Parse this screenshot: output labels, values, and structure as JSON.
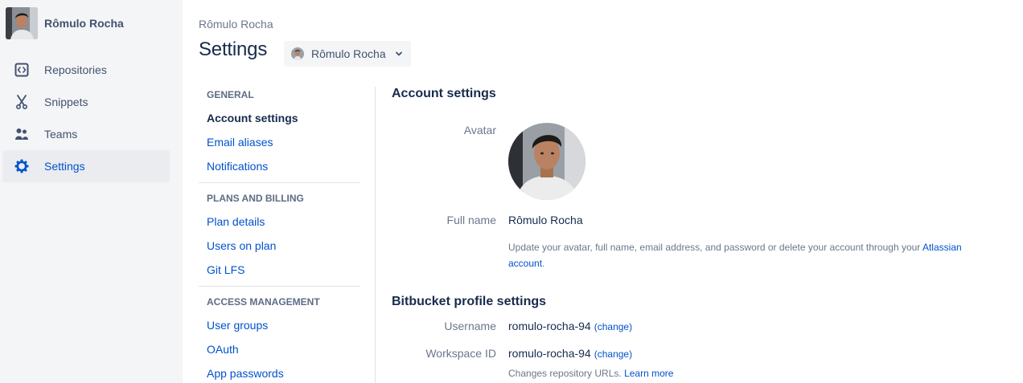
{
  "sidebar": {
    "user_name": "Rômulo Rocha",
    "items": [
      {
        "label": "Repositories",
        "icon": "code-icon"
      },
      {
        "label": "Snippets",
        "icon": "scissors-icon"
      },
      {
        "label": "Teams",
        "icon": "people-icon"
      },
      {
        "label": "Settings",
        "icon": "gear-icon"
      }
    ],
    "active_item": "Settings"
  },
  "header": {
    "breadcrumb": "Rômulo Rocha",
    "title": "Settings",
    "workspace_select": "Rômulo Rocha"
  },
  "menu": {
    "sections": [
      {
        "heading": "GENERAL",
        "items": [
          "Account settings",
          "Email aliases",
          "Notifications"
        ]
      },
      {
        "heading": "PLANS AND BILLING",
        "items": [
          "Plan details",
          "Users on plan",
          "Git LFS"
        ]
      },
      {
        "heading": "ACCESS MANAGEMENT",
        "items": [
          "User groups",
          "OAuth",
          "App passwords"
        ]
      }
    ],
    "active_item": "Account settings"
  },
  "account": {
    "title": "Account settings",
    "avatar_label": "Avatar",
    "full_name_label": "Full name",
    "full_name": "Rômulo Rocha",
    "help_prefix": "Update your avatar, full name, email address, and password or delete your account through your ",
    "help_link": "Atlassian account",
    "help_suffix": "."
  },
  "profile": {
    "title": "Bitbucket profile settings",
    "username_label": "Username",
    "username": "romulo-rocha-94",
    "workspace_id_label": "Workspace ID",
    "workspace_id": "romulo-rocha-94",
    "change_label": "(change)",
    "urls_note": "Changes repository URLs.",
    "learn_more": "Learn more"
  },
  "colors": {
    "sidebar_bg": "#f4f5f7",
    "active_bg": "#ebecf0",
    "link": "#0052cc",
    "text": "#172b4d",
    "muted": "#6b778c"
  }
}
